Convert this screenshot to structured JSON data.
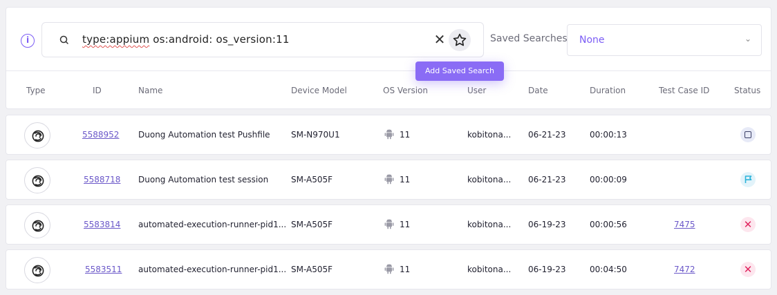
{
  "search": {
    "query_prefix": "type:appium",
    "query_rest": " os:android: os_version:11",
    "saved_searches_label": "Saved Searches",
    "saved_searches_value": "None",
    "add_saved_search_tooltip": "Add Saved Search"
  },
  "table": {
    "headers": [
      "Type",
      "ID",
      "Name",
      "Device Model",
      "OS Version",
      "User",
      "Date",
      "Duration",
      "Test Case ID",
      "Status"
    ],
    "rows": [
      {
        "type": "appium",
        "id": "5588952",
        "name": "Duong Automation test Pushfile",
        "device": "SM-N970U1",
        "os_version": "11",
        "user": "kobitona...",
        "date": "06-21-23",
        "duration": "00:00:13",
        "test_case_id": "",
        "status": "stopped"
      },
      {
        "type": "appium",
        "id": "5588718",
        "name": "Duong Automation test session",
        "device": "SM-A505F",
        "os_version": "11",
        "user": "kobitona...",
        "date": "06-21-23",
        "duration": "00:00:09",
        "test_case_id": "",
        "status": "flagged"
      },
      {
        "type": "appium",
        "id": "5583814",
        "name": "automated-execution-runner-pid1...",
        "device": "SM-A505F",
        "os_version": "11",
        "user": "kobitona...",
        "date": "06-19-23",
        "duration": "00:00:56",
        "test_case_id": "7475",
        "status": "failed"
      },
      {
        "type": "appium",
        "id": "5583511",
        "name": "automated-execution-runner-pid1...",
        "device": "SM-A505F",
        "os_version": "11",
        "user": "kobitona...",
        "date": "06-19-23",
        "duration": "00:04:50",
        "test_case_id": "7472",
        "status": "failed"
      }
    ]
  },
  "colors": {
    "accent": "#7b5cf5",
    "link": "#6b58c9",
    "fail": "#e0245e",
    "flag": "#2bb3d9"
  }
}
